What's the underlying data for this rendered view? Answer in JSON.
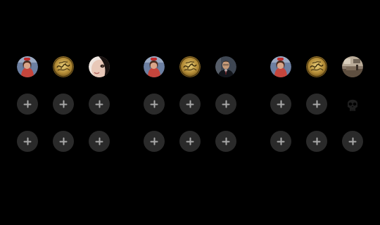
{
  "groups": [
    {
      "id": "group-1",
      "slots": [
        {
          "kind": "avatar",
          "icon": "woman-portrait-avatar"
        },
        {
          "kind": "avatar",
          "icon": "gold-calligraphy-emblem-avatar"
        },
        {
          "kind": "avatar",
          "icon": "face-closeup-avatar"
        },
        {
          "kind": "add",
          "icon": "plus-icon"
        },
        {
          "kind": "add",
          "icon": "plus-icon"
        },
        {
          "kind": "add",
          "icon": "plus-icon"
        },
        {
          "kind": "add",
          "icon": "plus-icon"
        },
        {
          "kind": "add",
          "icon": "plus-icon"
        },
        {
          "kind": "add",
          "icon": "plus-icon"
        }
      ]
    },
    {
      "id": "group-2",
      "slots": [
        {
          "kind": "avatar",
          "icon": "woman-portrait-avatar"
        },
        {
          "kind": "avatar",
          "icon": "gold-calligraphy-emblem-avatar"
        },
        {
          "kind": "avatar",
          "icon": "man-in-suit-avatar"
        },
        {
          "kind": "add",
          "icon": "plus-icon"
        },
        {
          "kind": "add",
          "icon": "plus-icon"
        },
        {
          "kind": "add",
          "icon": "plus-icon"
        },
        {
          "kind": "add",
          "icon": "plus-icon"
        },
        {
          "kind": "add",
          "icon": "plus-icon"
        },
        {
          "kind": "add",
          "icon": "plus-icon"
        }
      ]
    },
    {
      "id": "group-3",
      "slots": [
        {
          "kind": "avatar",
          "icon": "woman-portrait-avatar"
        },
        {
          "kind": "avatar",
          "icon": "gold-calligraphy-emblem-avatar"
        },
        {
          "kind": "avatar",
          "icon": "room-interior-avatar"
        },
        {
          "kind": "add",
          "icon": "plus-icon"
        },
        {
          "kind": "add",
          "icon": "plus-icon"
        },
        {
          "kind": "ghost",
          "icon": "dark-skull-icon"
        },
        {
          "kind": "add",
          "icon": "plus-icon"
        },
        {
          "kind": "add",
          "icon": "plus-icon"
        },
        {
          "kind": "add",
          "icon": "plus-icon"
        }
      ]
    }
  ],
  "colors": {
    "background": "#000000",
    "add_button_fill": "#2a2a2a",
    "plus_glyph": "#a9a9a9"
  }
}
